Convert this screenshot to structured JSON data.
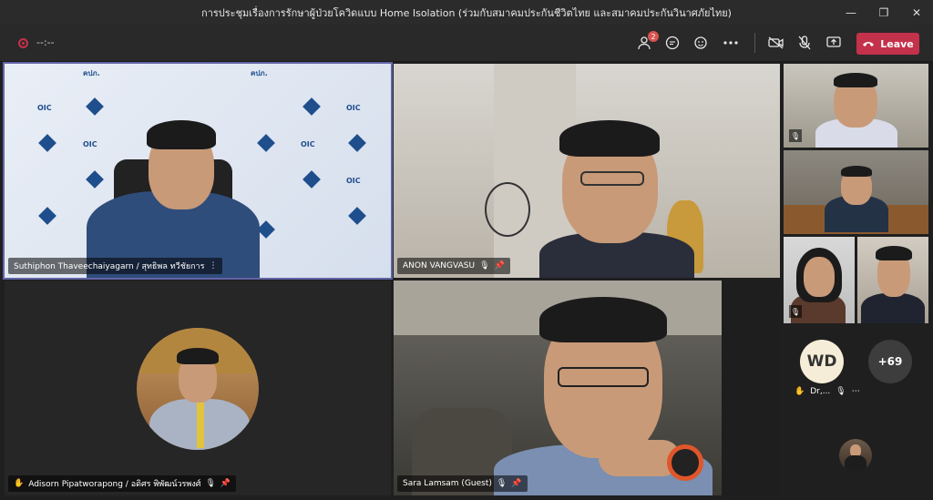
{
  "window": {
    "title": "การประชุมเรื่องการรักษาผู้ป่วยโควิดแบบ Home Isolation (ร่วมกับสมาคมประกันชีวิตไทย และสมาคมประกันวินาศภัยไทย)",
    "minimize": "—",
    "maximize": "❐",
    "close": "✕"
  },
  "toolbar": {
    "timer": "--:--",
    "participants_badge": "2",
    "leave_label": "Leave",
    "colors": {
      "leave": "#c4314b",
      "record": "#c4314b"
    }
  },
  "participants": {
    "suthiphon": {
      "name": "Suthiphon Thaveechaiyagarn / สุทธิพล ทวีชัยการ"
    },
    "anon": {
      "name": "ANON VANGVASU"
    },
    "adisorn": {
      "name": "Adisorn Pipatworapong / อดิศร พิพัฒน์วรพงศ์"
    },
    "sara": {
      "name": "Sara Lamsam (Guest)"
    },
    "wd": {
      "initials": "WD",
      "name": "Dr,..."
    },
    "overflow": {
      "count": "+69"
    }
  },
  "background": {
    "logo_text": "OIC",
    "thai_logo": "คปภ."
  }
}
